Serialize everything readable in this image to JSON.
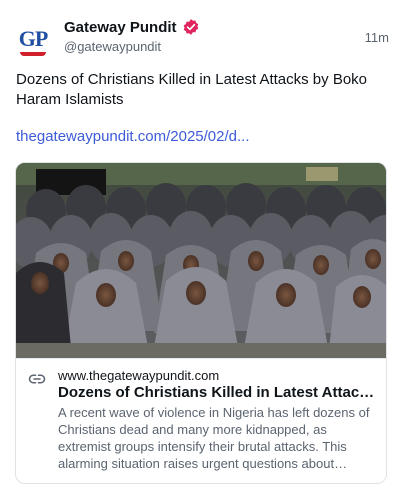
{
  "author": {
    "avatar_text": "GP",
    "display_name": "Gateway Pundit",
    "handle": "@gatewaypundit",
    "verified_color": "#e0245e"
  },
  "post": {
    "timestamp": "11m",
    "text": "Dozens of Christians Killed in Latest Attacks by Boko Haram Islamists",
    "link_text": "thegatewaypundit.com/2025/02/d..."
  },
  "card": {
    "domain": "www.thegatewaypundit.com",
    "title": "Dozens of Christians Killed in Latest Attacks by Boko Haram Islamists",
    "description": "A recent wave of violence in Nigeria has left dozens of Christians dead and many more kidnapped, as extremist groups intensify their brutal attacks. This alarming situation raises urgent questions about security in the region."
  },
  "colors": {
    "link": "#3d5bd9",
    "muted": "#5b6470",
    "brand_blue": "#1f4ea3",
    "brand_red": "#d11f2b"
  }
}
